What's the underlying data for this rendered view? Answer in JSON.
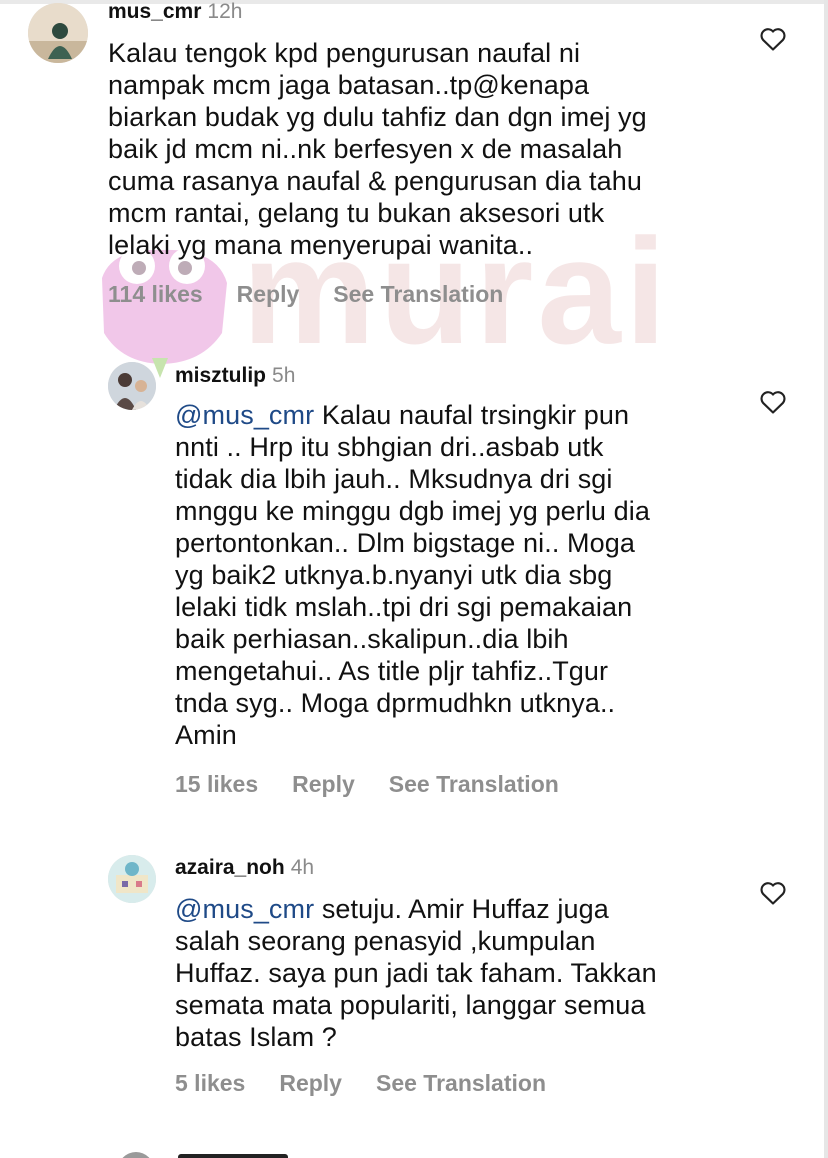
{
  "watermark": {
    "text": "murai"
  },
  "comments": [
    {
      "username": "mus_cmr",
      "time": "12h",
      "mention": "",
      "text": "Kalau tengok kpd pengurusan naufal ni\nnampak mcm jaga batasan..tp@kenapa\nbiarkan budak yg dulu tahfiz dan dgn imej yg\nbaik jd mcm ni..nk berfesyen x de masalah\ncuma rasanya naufal & pengurusan dia tahu\nmcm rantai, gelang tu bukan aksesori utk\nlelaki yg mana menyerupai wanita..",
      "likes": "114 likes",
      "reply": "Reply",
      "translate": "See Translation"
    },
    {
      "username": "misztulip",
      "time": "5h",
      "mention": "@mus_cmr",
      "text": " Kalau naufal trsingkir pun\nnnti .. Hrp itu sbhgian dri..asbab utk\ntidak dia lbih jauh.. Mksudnya dri sgi\nmnggu ke minggu dgb imej yg perlu dia\npertontonkan.. Dlm bigstage ni.. Moga\nyg baik2 utknya.b.nyanyi utk dia sbg\nlelaki tidk mslah..tpi dri sgi pemakaian\nbaik perhiasan..skalipun..dia  lbih\nmengetahui.. As title pljr tahfiz..Tgur\ntnda syg.. Moga dprmudhkn utknya..\nAmin",
      "likes": "15 likes",
      "reply": "Reply",
      "translate": "See Translation"
    },
    {
      "username": "azaira_noh",
      "time": "4h",
      "mention": "@mus_cmr",
      "text": " setuju. Amir Huffaz juga\nsalah seorang penasyid ,kumpulan\nHuffaz. saya pun jadi tak faham. Takkan\nsemata mata populariti, langgar semua\nbatas Islam ?",
      "likes": "5 likes",
      "reply": "Reply",
      "translate": "See Translation"
    }
  ]
}
